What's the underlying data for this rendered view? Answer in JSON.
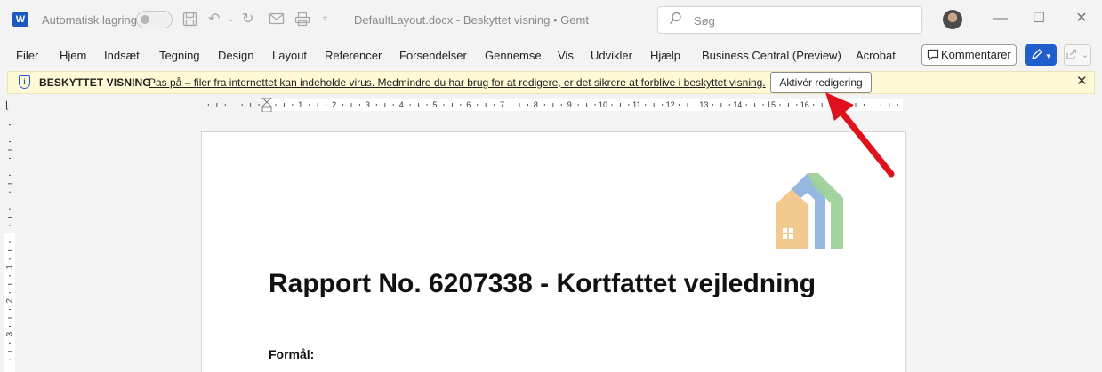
{
  "titlebar": {
    "app_icon_letter": "W",
    "autosave_label": "Automatisk lagring",
    "document_title": "DefaultLayout.docx  -  Beskyttet visning  •  Gemt",
    "search_placeholder": "Søg"
  },
  "ribbon": {
    "tabs": [
      {
        "label": "Filer"
      },
      {
        "label": "Hjem"
      },
      {
        "label": "Indsæt"
      },
      {
        "label": "Tegning"
      },
      {
        "label": "Design"
      },
      {
        "label": "Layout"
      },
      {
        "label": "Referencer"
      },
      {
        "label": "Forsendelser"
      },
      {
        "label": "Gennemse"
      },
      {
        "label": "Vis"
      },
      {
        "label": "Udvikler"
      },
      {
        "label": "Hjælp"
      },
      {
        "label": "Business Central (Preview)"
      },
      {
        "label": "Acrobat"
      }
    ],
    "comments_label": "Kommentarer"
  },
  "protected_view": {
    "title": "BESKYTTET VISNING",
    "message": "Pas på – filer fra internettet kan indeholde virus. Medmindre du har brug for at redigere, er det sikrere at forblive i beskyttet visning.",
    "enable_button": "Aktivér redigering"
  },
  "ruler": {
    "h_numbers": [
      "1",
      "2",
      "3",
      "4",
      "5",
      "6",
      "7",
      "8",
      "9",
      "10",
      "11",
      "12",
      "13",
      "14",
      "15",
      "16"
    ],
    "v_numbers": [
      "1",
      "2",
      "3"
    ]
  },
  "document": {
    "title": "Rapport No. 6207338 - Kortfattet vejledning",
    "heading": "Formål:"
  },
  "colors": {
    "accent": "#1f5fcc",
    "banner_bg": "#fff9d6",
    "annotation_arrow": "#e0101c",
    "logo_orange": "#f2c98f",
    "logo_blue": "#8fb4de",
    "logo_green": "#9fd19a"
  }
}
